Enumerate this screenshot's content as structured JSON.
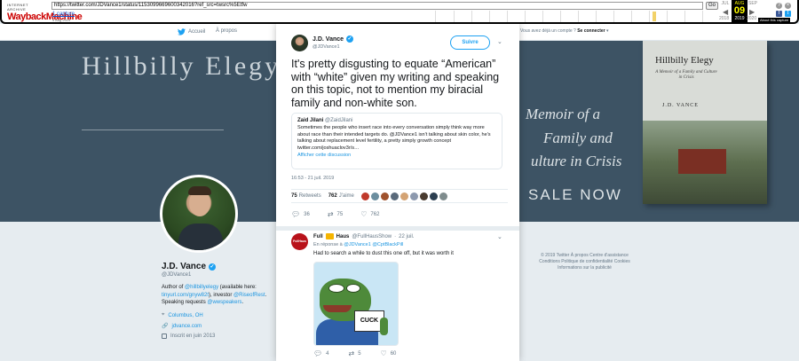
{
  "wayback": {
    "logo_top": "INTERNET ARCHIVE",
    "logo_main": "WaybackMachine",
    "url": "https://twitter.com/JDVance1/status/1153099669600342016?ref_src=twsrc%5Etfw",
    "go_label": "Go",
    "captures_label": "1 capture",
    "capture_date": "9 Aug 2019",
    "month_prev": "JUL",
    "month_active": "AUG",
    "month_next": "SEP",
    "day_active": "09",
    "year_prev": "2018",
    "year_active": "2019",
    "year_next": "2020",
    "about_label": "About this capture"
  },
  "twitter_nav": {
    "home_label": "Accueil",
    "about_label": "À propos",
    "account_prompt": "Vous avez déjà un compte ?",
    "login_label": "Se connecter"
  },
  "banner": {
    "title_fragment": "Hillbilly Elegy",
    "memoir_line1": "Memoir of a",
    "memoir_line2": "Family and",
    "memoir_line3": "ulture in Crisis",
    "sale_text": "SALE NOW",
    "book_title": "Hillbilly Elegy",
    "book_subtitle": "A Memoir of a Family and Culture in Crisis",
    "book_author": "J.D. VANCE"
  },
  "profile": {
    "name": "J.D. Vance",
    "handle": "@JDVance1",
    "bio_prefix": "Author of ",
    "bio_link1": "@hillbillyelegy",
    "bio_mid1": " (available here: ",
    "bio_link2": "tinyurl.com/gnyw82t",
    "bio_mid2": "), investor ",
    "bio_link3": "@RiseofRest",
    "bio_mid3": ". Speaking requests ",
    "bio_link4": "@wwspeakers",
    "bio_end": ".",
    "location": "Columbus, OH",
    "website": "jdvance.com",
    "joined": "Inscrit en juin 2013"
  },
  "footer": {
    "line1": "© 2019 Twitter   À propos   Centre d'assistance",
    "line2": "Conditions   Politique de confidentialité   Cookies",
    "line3": "Informations sur la publicité"
  },
  "tweet": {
    "author_name": "J.D. Vance",
    "author_handle": "@JDVance1",
    "follow_label": "Suivre",
    "text": "It's pretty disgusting to equate “American” with “white” given my writing and speaking on this topic, not to mention my biracial family and non-white son.",
    "quote": {
      "name": "Zaid Jilani",
      "handle": "@ZaidJilani",
      "text": "Sometimes the people who insert race into every conversation simply think way more about race than their intended targets do. @JDVance1 isn't talking about skin color, he's talking about replacement level fertility, a pretty simply growth concept twitter.com/joshuaclov3r/s…",
      "more_label": "Afficher cette discussion"
    },
    "timestamp": "16:53 - 21 juil. 2019",
    "retweets_count": "75",
    "retweets_label": "Retweets",
    "likes_count": "762",
    "likes_label": "J'aime",
    "likers_colors": [
      "#c0392b",
      "#6b8e9f",
      "#a0522d",
      "#5a6a7a",
      "#d4a373",
      "#8d99ae",
      "#4a3b2f",
      "#2c3e50",
      "#7f8c8d"
    ],
    "action_reply_count": "36",
    "action_retweet_count": "75",
    "action_like_count": "762"
  },
  "reply": {
    "avatar_text": "FullHaus",
    "name": "Full",
    "name2": "Haus",
    "handle": "@FullHausShow",
    "date": "22 juil.",
    "reply_prefix": "En réponse à",
    "reply_to1": "@JDVance1",
    "reply_to2": "@CptBlackPill",
    "text": "Had to search a while to dust this one off, but it was worth it",
    "sign_text": "CUCK",
    "action_reply_count": "4",
    "action_retweet_count": "5",
    "action_like_count": "60"
  },
  "colors": {
    "accent": "#1da1f2",
    "banner_bg": "#3d5364",
    "wayback_highlight": "#f2d269"
  }
}
